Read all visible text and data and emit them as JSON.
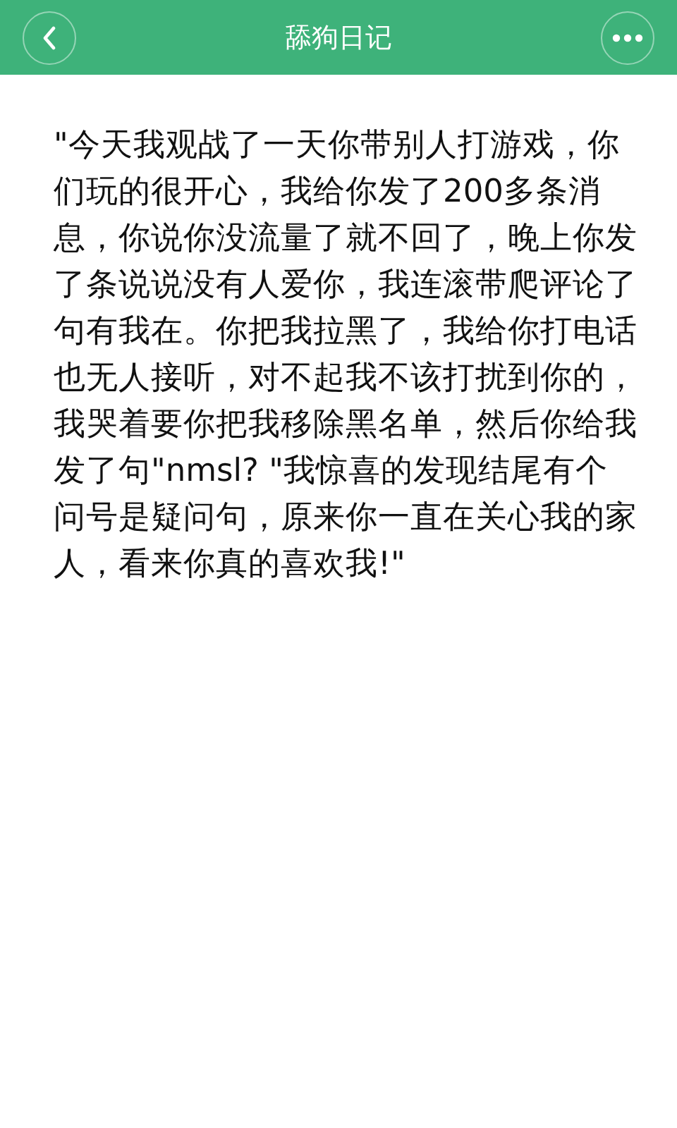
{
  "nav_bar": {
    "title": "舔狗日记"
  },
  "content": {
    "paragraph": "\"今天我观战了一天你带别人打游戏，你们玩的很开心，我给你发了200多条消息，你说你没流量了就不回了，晚上你发了条说说没有人爱你，我连滚带爬评论了句有我在。你把我拉黑了，我给你打电话也无人接听，对不起我不该打扰到你的，我哭着要你把我移除黑名单，然后你给我发了句\"nmsl? \"我惊喜的发现结尾有个问号是疑问句，原来你一直在关心我的家人，看来你真的喜欢我!\""
  }
}
